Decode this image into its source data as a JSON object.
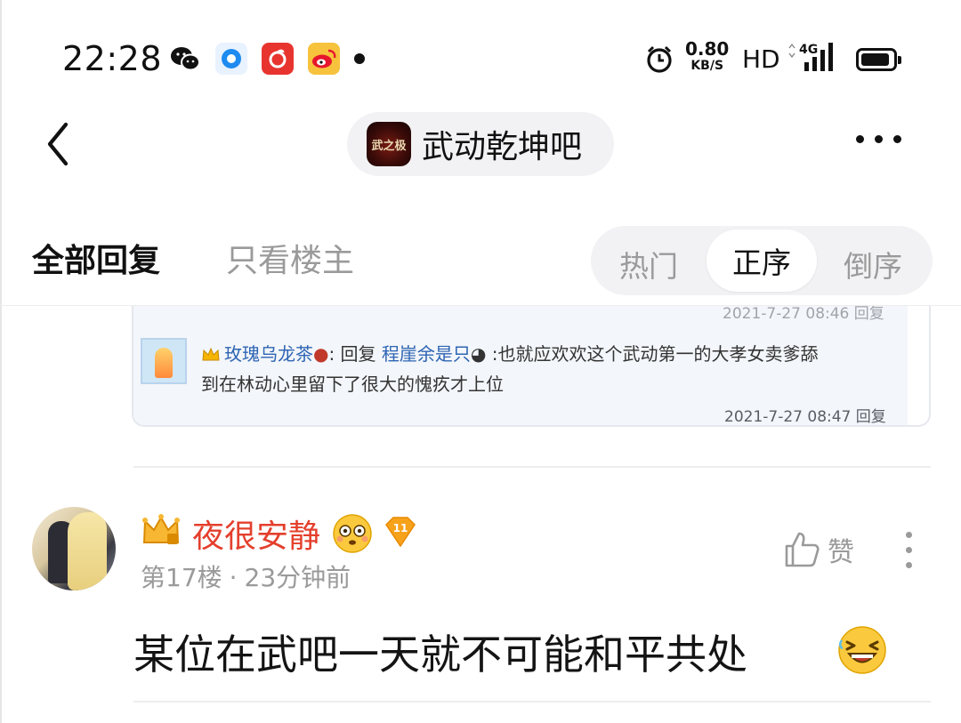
{
  "status_bar": {
    "time": "22:28",
    "net_speed_value": "0.80",
    "net_speed_unit": "KB/S",
    "hd_label": "HD",
    "network_label": "4G",
    "icons": [
      "wechat-icon",
      "browser-icon",
      "netease-music-icon",
      "weibo-icon",
      "notification-dot-icon",
      "alarm-icon",
      "signal-icon",
      "battery-icon"
    ]
  },
  "header": {
    "forum_name": "武动乾坤吧",
    "forum_logo_text": "武之极"
  },
  "tabs": {
    "all_replies": "全部回复",
    "owner_only": "只看楼主"
  },
  "sort": {
    "hot": "热门",
    "asc": "正序",
    "desc": "倒序",
    "selected": "正序"
  },
  "quoted_screenshot": {
    "faded_time": "2021-7-27 08:46 回复",
    "user": "玫瑰乌龙茶",
    "reply_word": ": 回复 ",
    "reply_to": "程崖余是只",
    "line1_rest": " :也就应欢欢这个武动第一的大孝女卖爹舔",
    "line2": "到在林动心里留下了很大的愧疚才上位",
    "time": "2021-7-27 08:47 回复"
  },
  "post": {
    "username": "夜很安静",
    "level": "11",
    "floor": "第17楼",
    "separator": "·",
    "time_ago": "23分钟前",
    "like_label": "赞",
    "content": "某位在武吧一天就不可能和平共处"
  },
  "colors": {
    "username_red": "#e43f2d",
    "level_badge_orange": "#f7a21b",
    "muted_gray": "#9a9a9a",
    "link_blue": "#2d64b3"
  }
}
